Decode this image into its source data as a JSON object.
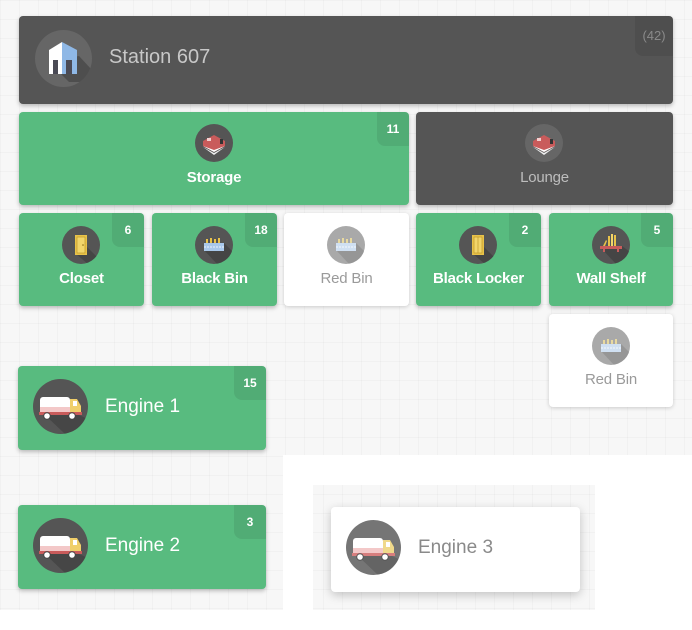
{
  "station": {
    "title": "Station 607",
    "count": "(42)",
    "icon": "building-icon"
  },
  "rooms": [
    {
      "label": "Storage",
      "count": "11",
      "state": "active",
      "icon": "room-icon"
    },
    {
      "label": "Lounge",
      "count": null,
      "state": "inactive",
      "icon": "room-icon"
    }
  ],
  "containers": [
    {
      "label": "Closet",
      "count": "6",
      "state": "active",
      "icon": "door-icon"
    },
    {
      "label": "Black Bin",
      "count": "18",
      "state": "active",
      "icon": "bin-icon"
    },
    {
      "label": "Red Bin",
      "count": null,
      "state": "empty",
      "icon": "bin-icon"
    },
    {
      "label": "Black Locker",
      "count": "2",
      "state": "active",
      "icon": "locker-icon"
    },
    {
      "label": "Wall Shelf",
      "count": "5",
      "state": "active",
      "icon": "shelf-icon"
    },
    {
      "label": "Red Bin",
      "count": null,
      "state": "empty",
      "icon": "bin-icon"
    }
  ],
  "engines": [
    {
      "label": "Engine 1",
      "count": "15",
      "state": "active",
      "icon": "truck-icon"
    },
    {
      "label": "Engine 2",
      "count": "3",
      "state": "active",
      "icon": "truck-icon"
    },
    {
      "label": "Engine 3",
      "count": null,
      "state": "empty",
      "icon": "truck-icon"
    }
  ],
  "colors": {
    "active": "#58bb7f",
    "inactive": "#555555",
    "empty": "#ffffff"
  }
}
